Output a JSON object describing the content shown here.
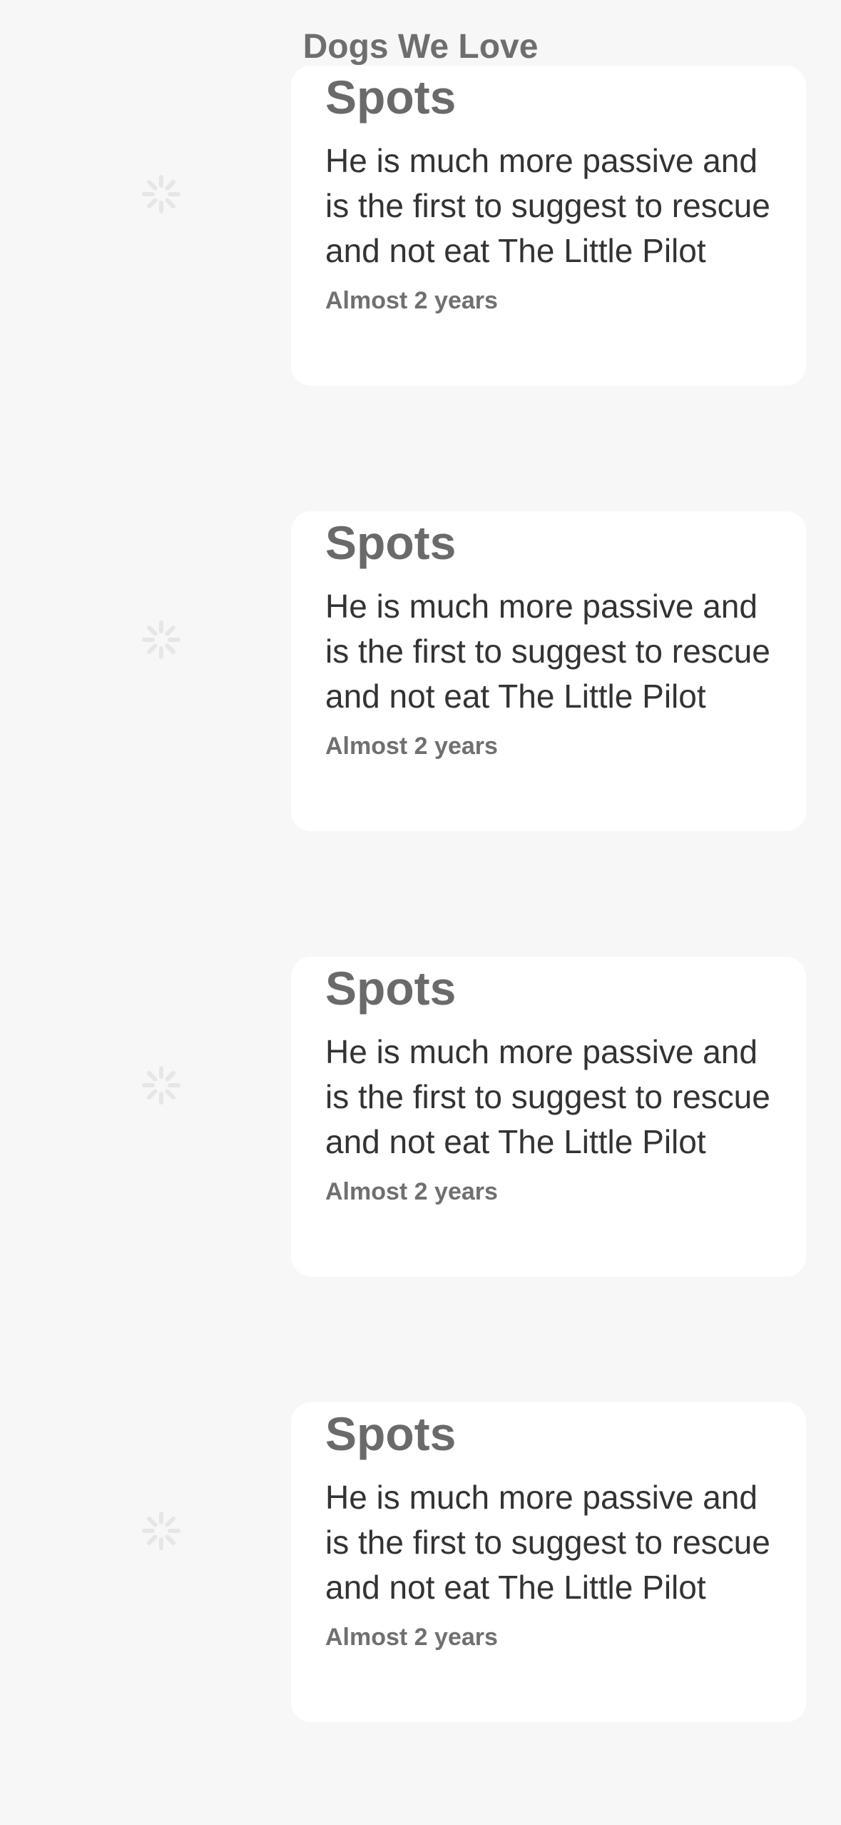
{
  "header": {
    "title": "Dogs We Love"
  },
  "dogs": [
    {
      "name": "Spots",
      "description": "He is much more passive and is the first to suggest to rescue and not eat The Little Pilot",
      "age": "Almost 2 years"
    },
    {
      "name": "Spots",
      "description": "He is much more passive and is the first to suggest to rescue and not eat The Little Pilot",
      "age": "Almost 2 years"
    },
    {
      "name": "Spots",
      "description": "He is much more passive and is the first to suggest to rescue and not eat The Little Pilot",
      "age": "Almost 2 years"
    },
    {
      "name": "Spots",
      "description": "He is much more passive and is the first to suggest to rescue and not eat The Little Pilot",
      "age": "Almost 2 years"
    }
  ],
  "icons": {
    "image_placeholder": "loading-spinner-icon"
  },
  "colors": {
    "background": "#f7f7f7",
    "card": "#ffffff",
    "title_text": "#6a6a6a",
    "body_text": "#333333"
  }
}
